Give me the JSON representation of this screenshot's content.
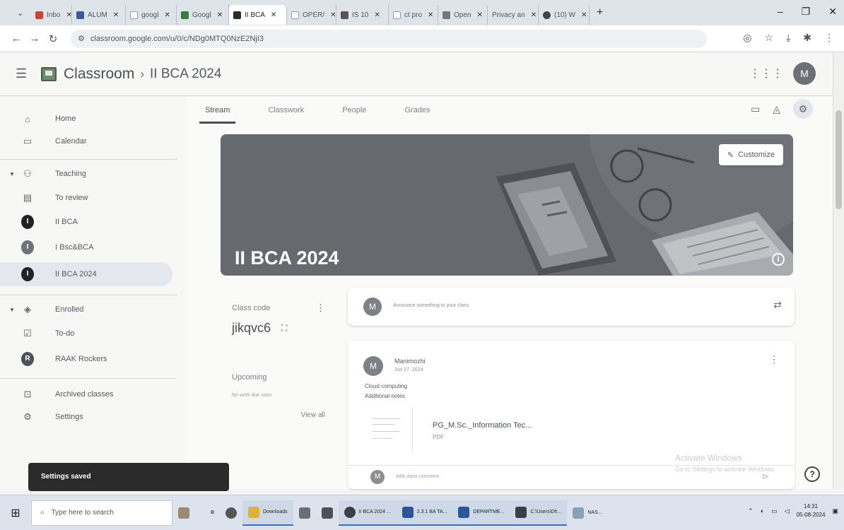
{
  "browser": {
    "tabs": [
      {
        "label": "Inbo"
      },
      {
        "label": "ALUM"
      },
      {
        "label": "googl"
      },
      {
        "label": "Googl"
      },
      {
        "label": "II BCA",
        "active": true
      },
      {
        "label": "OPER/"
      },
      {
        "label": "IS 10"
      },
      {
        "label": "ct pro"
      },
      {
        "label": "Open"
      },
      {
        "label": "Privacy an"
      },
      {
        "label": "(10) W"
      }
    ],
    "new_tab": "+",
    "url": "classroom.google.com/u/0/c/NDg0MTQ0NzE2NjI3",
    "window": {
      "minimize": "–",
      "maximize": "❐",
      "close": "✕"
    }
  },
  "header": {
    "app_title": "Classroom",
    "crumb_sep": "›",
    "class_crumb": "II BCA 2024",
    "account_initial": "M"
  },
  "sidebar": {
    "home": "Home",
    "calendar": "Calendar",
    "teaching": "Teaching",
    "to_review": "To review",
    "classes_teaching": [
      {
        "label": "II BCA",
        "initial": "I"
      },
      {
        "label": "I Bsc&BCA",
        "initial": "I"
      },
      {
        "label": "II BCA 2024",
        "initial": "I"
      }
    ],
    "enrolled": "Enrolled",
    "todo": "To-do",
    "classes_enrolled": [
      {
        "label": "RAAK Rockers",
        "initial": "R"
      }
    ],
    "archived": "Archived classes",
    "settings": "Settings"
  },
  "tabs": {
    "stream": "Stream",
    "classwork": "Classwork",
    "people": "People",
    "grades": "Grades"
  },
  "banner": {
    "title": "II BCA 2024",
    "customize": "Customize"
  },
  "class_code": {
    "label": "Class code",
    "value": "jikqvc6"
  },
  "upcoming": {
    "title": "Upcoming",
    "none": "No work due soon",
    "view_all": "View all"
  },
  "announce": {
    "avatar": "M",
    "placeholder": "Announce something to your class"
  },
  "post": {
    "avatar": "M",
    "author": "Manimozhi",
    "date": "Jun 27, 2024",
    "line1": "Cloud computing",
    "line2": "Additional notes",
    "attachment_name": "PG_M.Sc._Information Tec...",
    "attachment_type": "PDF",
    "comment_avatar": "M",
    "comment_placeholder": "Add class comment"
  },
  "watermark": {
    "line1": "Activate Windows",
    "line2": "Go to Settings to activate Windows."
  },
  "help": "?",
  "toast": "Settings saved",
  "taskbar": {
    "search_placeholder": "Type here to search",
    "items": [
      {
        "label": "Downloads"
      },
      {
        "label": "II BCA 2024 ..."
      },
      {
        "label": "2.3.1 BA TA..."
      },
      {
        "label": "DEPARTME..."
      },
      {
        "label": "C:\\Users\\Dh..."
      },
      {
        "label": "NAS..."
      }
    ],
    "time": "14:31",
    "date": "05-08-2024"
  }
}
